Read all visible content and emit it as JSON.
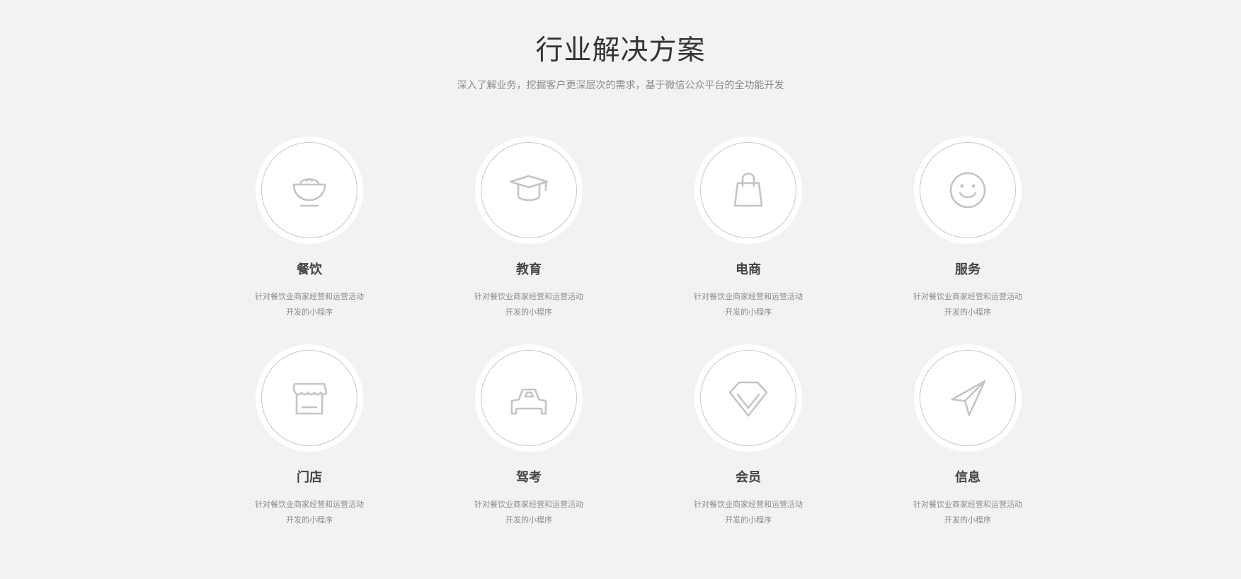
{
  "header": {
    "title": "行业解决方案",
    "subtitle": "深入了解业务，挖掘客户更深层次的需求，基于微信公众平台的全功能开发"
  },
  "solutions": [
    {
      "title": "餐饮",
      "icon": "bowl-icon",
      "desc_line1": "针对餐饮业商家经营和运营活动",
      "desc_line2": "开发的小程序"
    },
    {
      "title": "教育",
      "icon": "graduation-cap-icon",
      "desc_line1": "针对餐饮业商家经营和运营活动",
      "desc_line2": "开发的小程序"
    },
    {
      "title": "电商",
      "icon": "shopping-bag-icon",
      "desc_line1": "针对餐饮业商家经营和运营活动",
      "desc_line2": "开发的小程序"
    },
    {
      "title": "服务",
      "icon": "smiley-icon",
      "desc_line1": "针对餐饮业商家经营和运营活动",
      "desc_line2": "开发的小程序"
    },
    {
      "title": "门店",
      "icon": "store-icon",
      "desc_line1": "针对餐饮业商家经营和运营活动",
      "desc_line2": "开发的小程序"
    },
    {
      "title": "驾考",
      "icon": "car-icon",
      "desc_line1": "针对餐饮业商家经营和运营活动",
      "desc_line2": "开发的小程序"
    },
    {
      "title": "会员",
      "icon": "diamond-icon",
      "desc_line1": "针对餐饮业商家经营和运营活动",
      "desc_line2": "开发的小程序"
    },
    {
      "title": "信息",
      "icon": "paper-plane-icon",
      "desc_line1": "针对餐饮业商家经营和运营活动",
      "desc_line2": "开发的小程序"
    }
  ],
  "colors": {
    "background": "#f2f2f2",
    "icon_stroke": "#c4c4c4",
    "title_text": "#333333",
    "muted_text": "#8a8a8a"
  }
}
